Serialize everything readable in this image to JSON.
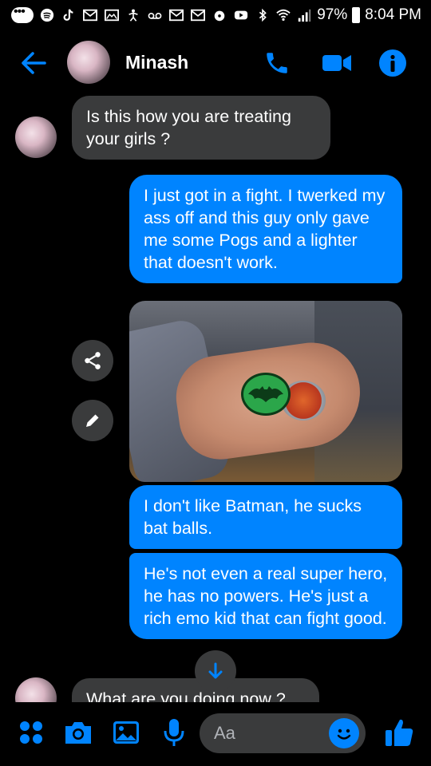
{
  "status_bar": {
    "battery": "97%",
    "time": "8:04 PM"
  },
  "header": {
    "contact_name": "Minash"
  },
  "messages": [
    {
      "direction": "in",
      "text": "Is this how you are treating your girls ?"
    },
    {
      "direction": "out",
      "text": "I just got in a fight. I twerked my ass off and this guy only gave me some Pogs and a lighter that doesn't work."
    },
    {
      "direction": "out",
      "type": "photo",
      "text": ""
    },
    {
      "direction": "out",
      "text": "I don't like Batman, he sucks bat balls."
    },
    {
      "direction": "out",
      "text": "He's not even a real super hero, he has no powers. He's just a rich emo kid that can fight good."
    },
    {
      "direction": "in",
      "text": "What are you doing now ?"
    }
  ],
  "composer": {
    "placeholder": "Aa"
  },
  "colors": {
    "accent": "#0084ff",
    "incoming_bubble": "#3a3b3c",
    "background": "#000000"
  },
  "icons": {
    "back": "arrow-left-icon",
    "call": "phone-icon",
    "video": "video-camera-icon",
    "info": "info-icon",
    "share": "share-icon",
    "edit": "pencil-icon",
    "scroll": "arrow-down-icon",
    "menu": "four-dots-icon",
    "camera": "camera-icon",
    "gallery": "image-icon",
    "mic": "microphone-icon",
    "emoji": "smiley-icon",
    "like": "thumbs-up-icon"
  }
}
